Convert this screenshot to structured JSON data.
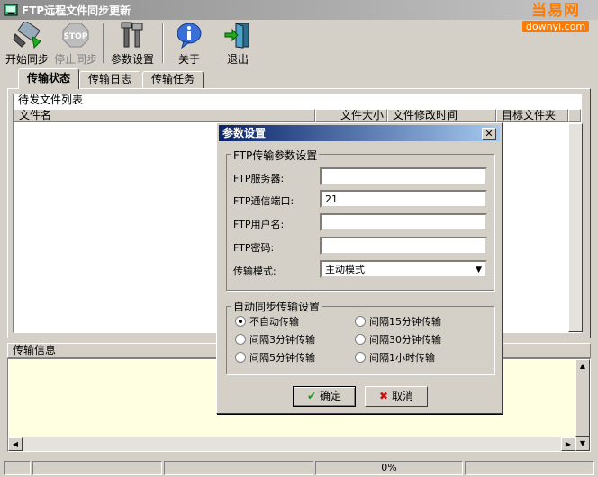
{
  "window": {
    "title": "FTP远程文件同步更新"
  },
  "watermark": {
    "brand": "当易网",
    "domain": "downyi.com"
  },
  "toolbar": {
    "start": {
      "label": "开始同步",
      "icon": "start-sync-icon"
    },
    "stop": {
      "label": "停止同步",
      "icon": "stop-sign-icon",
      "disabled": true
    },
    "settings": {
      "label": "参数设置",
      "icon": "tools-icon"
    },
    "about": {
      "label": "关于",
      "icon": "info-icon"
    },
    "exit": {
      "label": "退出",
      "icon": "exit-door-icon"
    }
  },
  "tabs": [
    {
      "label": "传输状态",
      "active": true
    },
    {
      "label": "传输日志",
      "active": false
    },
    {
      "label": "传输任务",
      "active": false
    }
  ],
  "pending": {
    "title": "待发文件列表",
    "columns": [
      "文件名",
      "文件大小",
      "文件修改时间",
      "目标文件夹"
    ]
  },
  "transfer_info": {
    "title": "传输信息"
  },
  "dialog": {
    "title": "参数设置",
    "ftp_group": {
      "title": "FTP传输参数设置",
      "server_label": "FTP服务器:",
      "server_value": "",
      "port_label": "FTP通信端口:",
      "port_value": "21",
      "user_label": "FTP用户名:",
      "user_value": "",
      "password_label": "FTP密码:",
      "password_value": "",
      "mode_label": "传输模式:",
      "mode_value": "主动模式"
    },
    "auto_group": {
      "title": "自动同步传输设置",
      "options": [
        "不自动传输",
        "间隔15分钟传输",
        "间隔3分钟传输",
        "间隔30分钟传输",
        "间隔5分钟传输",
        "间隔1小时传输"
      ],
      "selected": "不自动传输"
    },
    "ok_label": "确定",
    "cancel_label": "取消"
  },
  "status": {
    "progress": "0%",
    "progress_value": 0
  }
}
